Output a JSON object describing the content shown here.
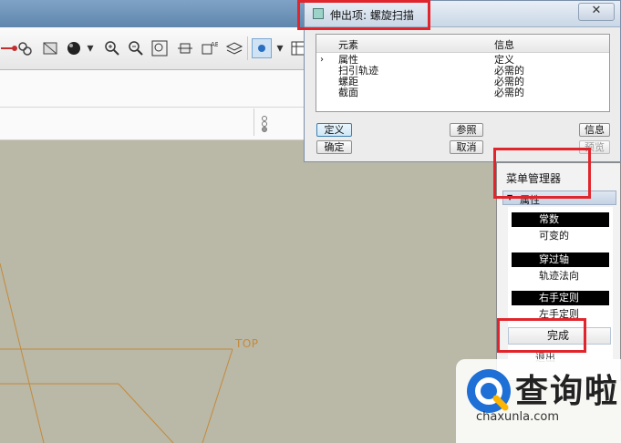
{
  "dialog": {
    "title": "伸出项: 螺旋扫描",
    "close_label": "✕",
    "columns": [
      "元素",
      "信息"
    ],
    "rows": [
      {
        "element": "属性",
        "info": "定义",
        "selected": true
      },
      {
        "element": "扫引轨迹",
        "info": "必需的",
        "selected": false
      },
      {
        "element": "螺距",
        "info": "必需的",
        "selected": false
      },
      {
        "element": "截面",
        "info": "必需的",
        "selected": false
      }
    ],
    "selected_marker": "›",
    "buttons": {
      "define": "定义",
      "reference": "参照",
      "info": "信息",
      "ok": "确定",
      "cancel": "取消",
      "preview": "预览"
    }
  },
  "menu_manager": {
    "title": "菜单管理器",
    "section_arrow": "▼",
    "section": "属性",
    "items": [
      {
        "label": "常数",
        "active": true
      },
      {
        "label": "可变的",
        "active": false
      },
      {
        "label": "穿过轴",
        "active": true
      },
      {
        "label": "轨迹法向",
        "active": false
      },
      {
        "label": "右手定则",
        "active": true
      },
      {
        "label": "左手定则",
        "active": false
      }
    ],
    "done": "完成",
    "exit": "退出"
  },
  "viewport": {
    "plane_label": "TOP"
  },
  "watermark": {
    "text": "查询啦",
    "url": "chaxunla.com"
  },
  "colors": {
    "annotation_red": "#e0262c",
    "viewport_bg": "#bab8a7",
    "sketch_line": "#c48a3a"
  },
  "icons": [
    "zoom-in-icon",
    "zoom-out-icon",
    "zoom-fit-icon",
    "shading-sphere-icon",
    "layer-icon",
    "datum-display-icon"
  ]
}
